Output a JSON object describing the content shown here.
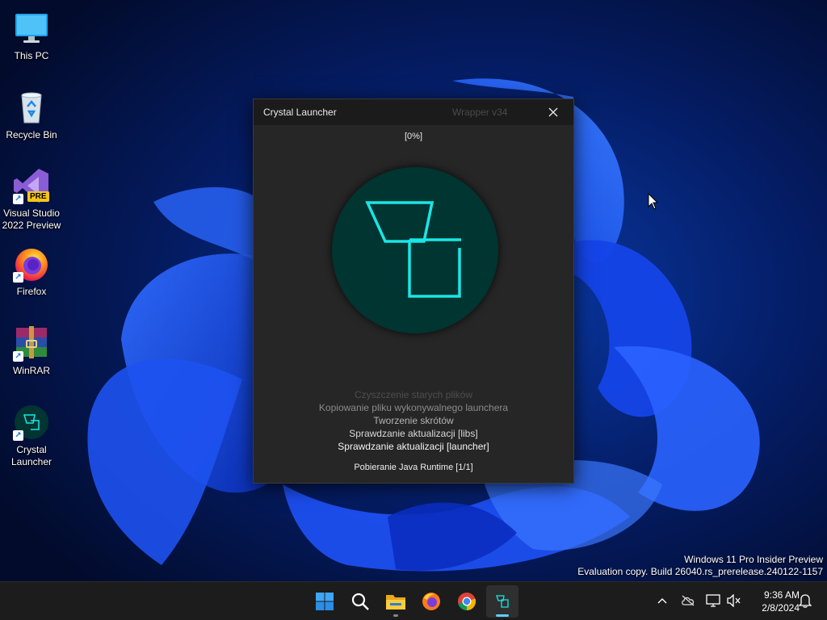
{
  "desktop": {
    "icons": [
      {
        "label": "This PC"
      },
      {
        "label": "Recycle Bin"
      },
      {
        "label": "Visual Studio 2022 Preview",
        "badge": "PRE"
      },
      {
        "label": "Firefox"
      },
      {
        "label": "WinRAR"
      },
      {
        "label": "Crystal Launcher"
      }
    ]
  },
  "launcher": {
    "title": "Crystal Launcher",
    "version": "Wrapper v34",
    "progress": "[0%]",
    "progress_value": 0,
    "steps": [
      "Czyszczenie starych plików",
      "Kopiowanie pliku wykonywalnego launchera",
      "Tworzenie skrótów",
      "Sprawdzanie aktualizacji [libs]",
      "Sprawdzanie aktualizacji [launcher]"
    ],
    "current_step": "Pobieranie Java Runtime [1/1]",
    "accent": "#19e6e6",
    "logo_bg": "#003531"
  },
  "watermark": {
    "line1": "Windows 11 Pro Insider Preview",
    "line2": "Evaluation copy. Build 26040.rs_prerelease.240122-1157"
  },
  "taskbar": {
    "apps": [
      "windows-start-icon",
      "search-icon",
      "file-explorer-icon",
      "firefox-icon",
      "chrome-icon",
      "crystal-launcher-icon"
    ],
    "tray": [
      "chevron-up-icon",
      "cloud-offline-icon",
      "network-icon",
      "volume-muted-icon",
      "notification-bell-icon"
    ],
    "time": "9:36 AM",
    "date": "2/8/2024"
  }
}
